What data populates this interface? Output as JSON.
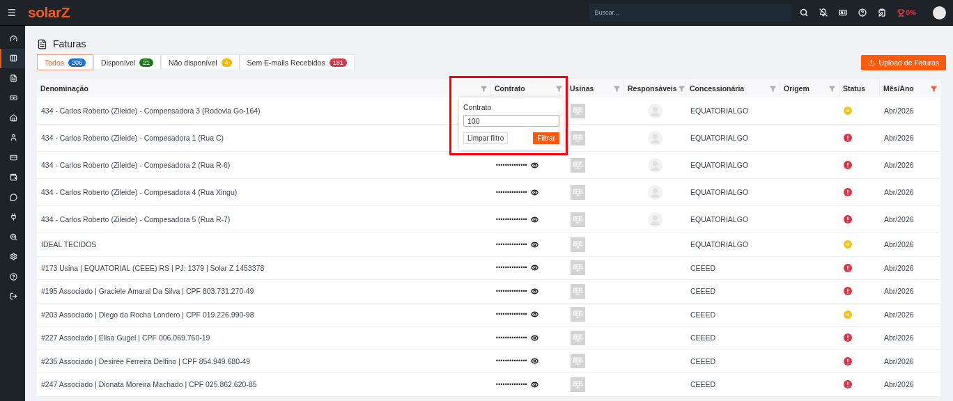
{
  "topbar": {
    "logo": "solarZ",
    "search": {
      "placeholder": "Buscar..."
    },
    "progress": "0%"
  },
  "sidebar": {
    "items": [
      {
        "selected": false
      },
      {
        "selected": true
      },
      {
        "selected": false
      },
      {
        "selected": false
      },
      {
        "selected": false
      },
      {
        "selected": false
      },
      {
        "selected": false
      },
      {
        "selected": false
      },
      {
        "selected": false
      },
      {
        "selected": false
      },
      {
        "selected": false
      },
      {
        "selected": false
      },
      {
        "selected": false
      },
      {
        "selected": false
      }
    ]
  },
  "page": {
    "title": "Faturas",
    "upload_button": "Upload de Faturas"
  },
  "tabs": [
    {
      "label": "Todos",
      "count": "206",
      "color": "#1f6fd1",
      "selected": true
    },
    {
      "label": "Disponível",
      "count": "21",
      "color": "#1e7b1e",
      "selected": false
    },
    {
      "label": "Não disponível",
      "count": "4",
      "color": "#f5b800",
      "selected": false
    },
    {
      "label": "Sem E-mails Recebidos",
      "count": "181",
      "color": "#dc3545",
      "selected": false
    }
  ],
  "table": {
    "columns": [
      {
        "label": "Denominação",
        "filtered": false
      },
      {
        "label": "Contrato",
        "filtered": false
      },
      {
        "label": "Usinas",
        "filtered": false
      },
      {
        "label": "Responsáveis",
        "filtered": false
      },
      {
        "label": "Concessionária",
        "filtered": false
      },
      {
        "label": "Origem",
        "filtered": false
      },
      {
        "label": "Status"
      },
      {
        "label": "Mês/Ano",
        "filtered": true
      }
    ],
    "rows": [
      {
        "name": "434 - Carlos Roberto (Zileide) - Compensadora 3 (Rodovia Go-164)",
        "has_avatar": true,
        "utility": "EQUATORIALGO",
        "status": {
          "kind": "pending"
        },
        "month": "Abr/2026"
      },
      {
        "name": "434 - Carlos Roberto (Zileide) - Compesadora 1 (Rua C)",
        "has_avatar": true,
        "utility": "EQUATORIALGO",
        "status": {
          "kind": "error"
        },
        "month": "Abr/2026"
      },
      {
        "name": "434 - Carlos Roberto (Zileide) - Compesadora 2 (Rua R-6)",
        "contract": "••••••••••••••",
        "has_avatar": true,
        "utility": "EQUATORIALGO",
        "status": {
          "kind": "error"
        },
        "month": "Abr/2026"
      },
      {
        "name": "434 - Carlos Roberto (Zileide) - Compesadora 4 (Rua Xingu)",
        "contract": "••••••••••••••",
        "has_avatar": true,
        "utility": "EQUATORIALGO",
        "status": {
          "kind": "error"
        },
        "month": "Abr/2026"
      },
      {
        "name": "434 - Carlos Roberto (Zileide) - Compesadora 5 (Rua R-7)",
        "contract": "••••••••••••••",
        "has_avatar": true,
        "utility": "EQUATORIALGO",
        "status": {
          "kind": "error"
        },
        "month": "Abr/2026"
      },
      {
        "name": "IDEAL TECIDOS",
        "contract": "••••••••••••••",
        "has_avatar": false,
        "utility": "EQUATORIALGO",
        "status": {
          "kind": "pending"
        },
        "month": "Abr/2026"
      },
      {
        "name": "#173 Usina | EQUATORIAL (CEEE) RS | PJ: 1379 | Solar Z 1453378",
        "contract": "••••••••••••••",
        "has_avatar": false,
        "utility": "CEEED",
        "status": {
          "kind": "error"
        },
        "month": "Abr/2026"
      },
      {
        "name": "#195 Associado | Graciele Amaral Da Silva | CPF 803.731.270-49",
        "contract": "••••••••••••••",
        "has_avatar": false,
        "utility": "CEEED",
        "status": {
          "kind": "error"
        },
        "month": "Abr/2026"
      },
      {
        "name": "#203 Associado | Diego da Rocha Londero | CPF 019.226.990-98",
        "contract": "••••••••••••••",
        "has_avatar": false,
        "utility": "CEEED",
        "status": {
          "kind": "pending"
        },
        "month": "Abr/2026"
      },
      {
        "name": "#227 Associado | Elisa Gugel | CPF 006.069.760-19",
        "contract": "••••••••••••••",
        "has_avatar": false,
        "utility": "CEEED",
        "status": {
          "kind": "error"
        },
        "month": "Abr/2026"
      },
      {
        "name": "#235 Associado | Desirée Ferreira Delfino | CPF 854.949.680-49",
        "contract": "••••••••••••••",
        "has_avatar": false,
        "utility": "CEEED",
        "status": {
          "kind": "error"
        },
        "month": "Abr/2026"
      },
      {
        "name": "#247 Associado | Dionata Moreira Machado | CPF 025.862.620-85",
        "contract": "••••••••••••••",
        "has_avatar": false,
        "utility": "CEEED",
        "status": {
          "kind": "error"
        },
        "month": "Abr/2026"
      }
    ]
  },
  "filter_popover": {
    "label": "Contrato",
    "value": "100",
    "clear_button": "Limpar filtro",
    "apply_button": "Filtrar"
  }
}
